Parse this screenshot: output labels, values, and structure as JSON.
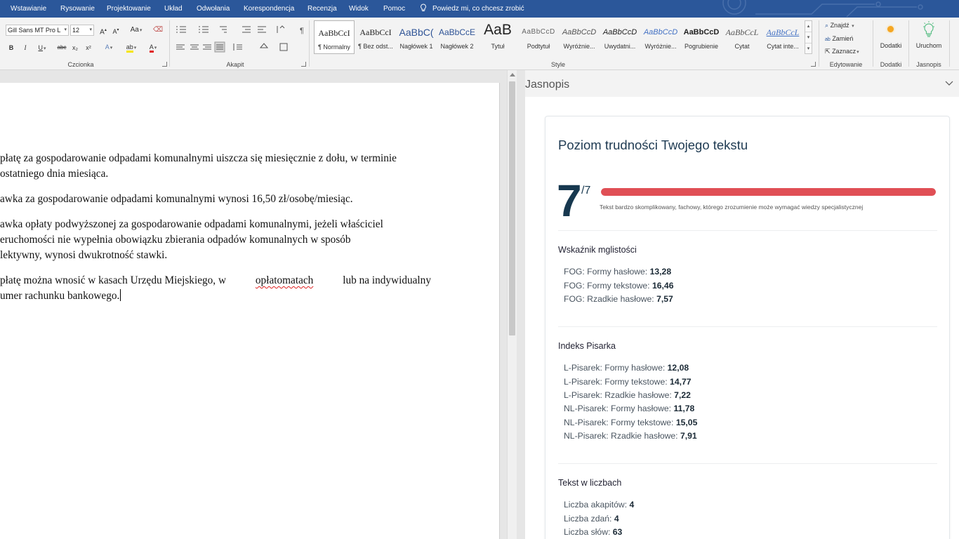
{
  "menu": {
    "tabs": [
      "Wstawianie",
      "Rysowanie",
      "Projektowanie",
      "Układ",
      "Odwołania",
      "Korespondencja",
      "Recenzja",
      "Widok",
      "Pomoc"
    ],
    "tell_me": "Powiedz mi, co chcesz zrobić"
  },
  "ribbon": {
    "font": {
      "name": "Gill Sans MT Pro L",
      "size": "12",
      "group_label": "Czcionka",
      "grow": "A",
      "shrink": "A",
      "change_case": "Aa",
      "bold": "B",
      "italic": "I",
      "underline": "U",
      "strike": "abc",
      "subscript": "x₂",
      "superscript": "x²",
      "effects": "A",
      "highlight": "ab",
      "font_color": "A"
    },
    "paragraph": {
      "group_label": "Akapit",
      "show_marks": "¶"
    },
    "styles": {
      "group_label": "Style",
      "items": [
        {
          "preview": "AaBbCcI",
          "label": "¶ Normalny"
        },
        {
          "preview": "AaBbCcI",
          "label": "¶ Bez odst..."
        },
        {
          "preview": "AaBbC(",
          "label": "Nagłówek 1"
        },
        {
          "preview": "AaBbCcE",
          "label": "Nagłówek 2"
        },
        {
          "preview": "AaB",
          "label": "Tytuł"
        },
        {
          "preview": "AaBbCcD",
          "label": "Podtytuł"
        },
        {
          "preview": "AaBbCcD",
          "label": "Wyróżnie..."
        },
        {
          "preview": "AaBbCcD",
          "label": "Uwydatni..."
        },
        {
          "preview": "AaBbCcD",
          "label": "Wyróżnie..."
        },
        {
          "preview": "AaBbCcD",
          "label": "Pogrubienie"
        },
        {
          "preview": "AaBbCcL",
          "label": "Cytat"
        },
        {
          "preview": "AaBbCcL",
          "label": "Cytat inte..."
        }
      ]
    },
    "editing": {
      "group_label": "Edytowanie",
      "find": "Znajdź",
      "replace": "Zamień",
      "select": "Zaznacz"
    },
    "addins": {
      "group_label": "Dodatki",
      "button": "Dodatki"
    },
    "jasnopis": {
      "group_label": "Jasnopis",
      "button": "Uruchom"
    }
  },
  "document": {
    "paragraphs": [
      [
        "płatę za gospodarowanie odpadami komunalnymi uiszcza się miesięcznie z dołu, w terminie",
        "ostatniego dnia miesiąca."
      ],
      [
        "awka za gospodarowanie odpadami komunalnymi wynosi 16,50 zł/osobę/miesiąc."
      ],
      [
        "awka opłaty podwyższonej za gospodarowanie odpadami komunalnymi, jeżeli właściciel",
        "eruchomości nie wypełnia obowiązku zbierania odpadów komunalnych w sposób",
        "lektywny, wynosi dwukrotność stawki."
      ],
      [
        "płatę można wnosić w kasach Urzędu Miejskiego, w",
        "opłatomatach",
        "lub na indywidualny",
        "umer rachunku bankowego."
      ]
    ]
  },
  "pane": {
    "title": "Jasnopis",
    "card_title": "Poziom trudności Twojego tekstu",
    "score": "7",
    "score_max": "/7",
    "score_fraction": 1.0,
    "score_desc": "Tekst bardzo skomplikowany, fachowy, którego zrozumienie może wymagać wiedzy specjalistycznej",
    "accent_color": "#e04f55",
    "sections": [
      {
        "title": "Wskaźnik mglistości",
        "metrics": [
          {
            "label": "FOG: Formy hasłowe:",
            "value": "13,28"
          },
          {
            "label": "FOG: Formy tekstowe:",
            "value": "16,46"
          },
          {
            "label": "FOG: Rzadkie hasłowe:",
            "value": "7,57"
          }
        ]
      },
      {
        "title": "Indeks Pisarka",
        "metrics": [
          {
            "label": "L-Pisarek: Formy hasłowe:",
            "value": "12,08"
          },
          {
            "label": "L-Pisarek: Formy tekstowe:",
            "value": "14,77"
          },
          {
            "label": "L-Pisarek: Rzadkie hasłowe:",
            "value": "7,22"
          },
          {
            "label": "NL-Pisarek: Formy hasłowe:",
            "value": "11,78"
          },
          {
            "label": "NL-Pisarek: Formy tekstowe:",
            "value": "15,05"
          },
          {
            "label": "NL-Pisarek: Rzadkie hasłowe:",
            "value": "7,91"
          }
        ]
      },
      {
        "title": "Tekst w liczbach",
        "metrics": [
          {
            "label": "Liczba akapitów:",
            "value": "4"
          },
          {
            "label": "Liczba zdań:",
            "value": "4"
          },
          {
            "label": "Liczba słów:",
            "value": "63"
          }
        ]
      }
    ]
  }
}
